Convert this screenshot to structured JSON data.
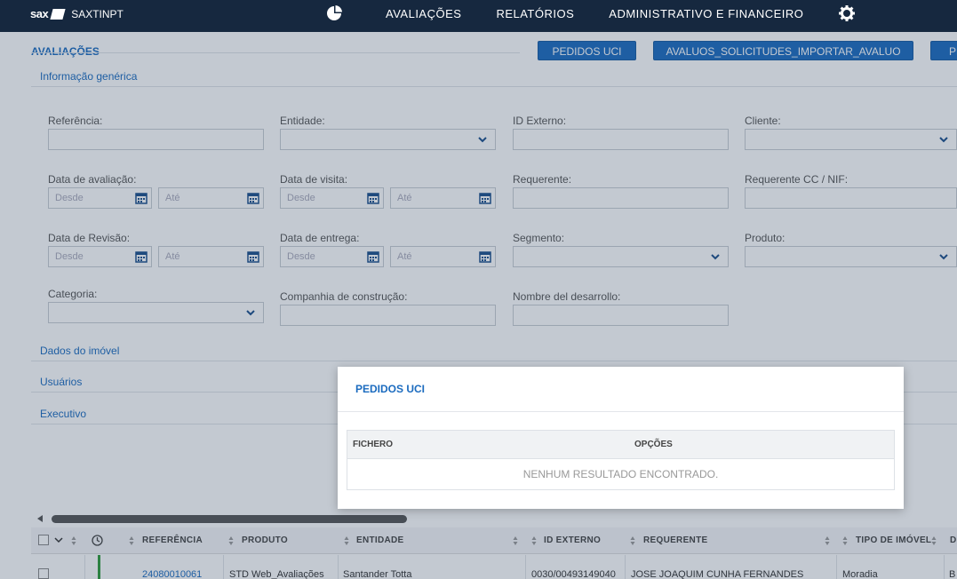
{
  "header": {
    "brand": "sax",
    "app_name": "SAXTINPT",
    "nav": [
      "AVALIAÇÕES",
      "RELATÓRIOS",
      "ADMINISTRATIVO E FINANCEIRO"
    ],
    "chart_icon": "pie-chart-icon",
    "settings_icon": "gear-icon"
  },
  "page": {
    "title": "AVALIAÇÕES",
    "buttons": [
      "PEDIDOS UCI",
      "AVALUOS_SOLICITUDES_IMPORTAR_AVALUO",
      "PR"
    ]
  },
  "sections": {
    "generic": "Informação genérica",
    "property": "Dados do imóvel",
    "users": "Usuários",
    "executive": "Executivo"
  },
  "filters": {
    "referencia": "Referência:",
    "entidade": "Entidade:",
    "id_externo": "ID Externo:",
    "cliente": "Cliente:",
    "data_avaliacao": "Data de avaliação:",
    "data_visita": "Data de visita:",
    "requerente": "Requerente:",
    "requerente_cc": "Requerente CC / NIF:",
    "data_revisao": "Data de Revisão:",
    "data_entrega": "Data de entrega:",
    "segmento": "Segmento:",
    "produto": "Produto:",
    "categoria": "Categoria:",
    "companhia": "Companhia de construção:",
    "desarrollo": "Nombre del desarrollo:",
    "desde": "Desde",
    "ate": "Até"
  },
  "modal": {
    "title": "PEDIDOS UCI",
    "columns": [
      "FICHERO",
      "OPÇÕES"
    ],
    "empty": "NENHUM RESULTADO ENCONTRADO."
  },
  "grid": {
    "columns": [
      "REFERÊNCIA",
      "PRODUTO",
      "ENTIDADE",
      "ID EXTERNO",
      "REQUERENTE",
      "TIPO DE IMÓVEL",
      "D"
    ],
    "rows": [
      {
        "referencia": "24080010061",
        "produto": "STD Web_Avaliações",
        "entidade": "Santander Totta",
        "id_externo": "0030/00493149040",
        "requerente": "JOSE JOAQUIM CUNHA FERNANDES",
        "tipo": "Moradia",
        "extra": "B"
      }
    ]
  },
  "colors": {
    "topbar": "#16283f",
    "accent": "#1b6bbf",
    "status_green": "#2e9c3a"
  }
}
